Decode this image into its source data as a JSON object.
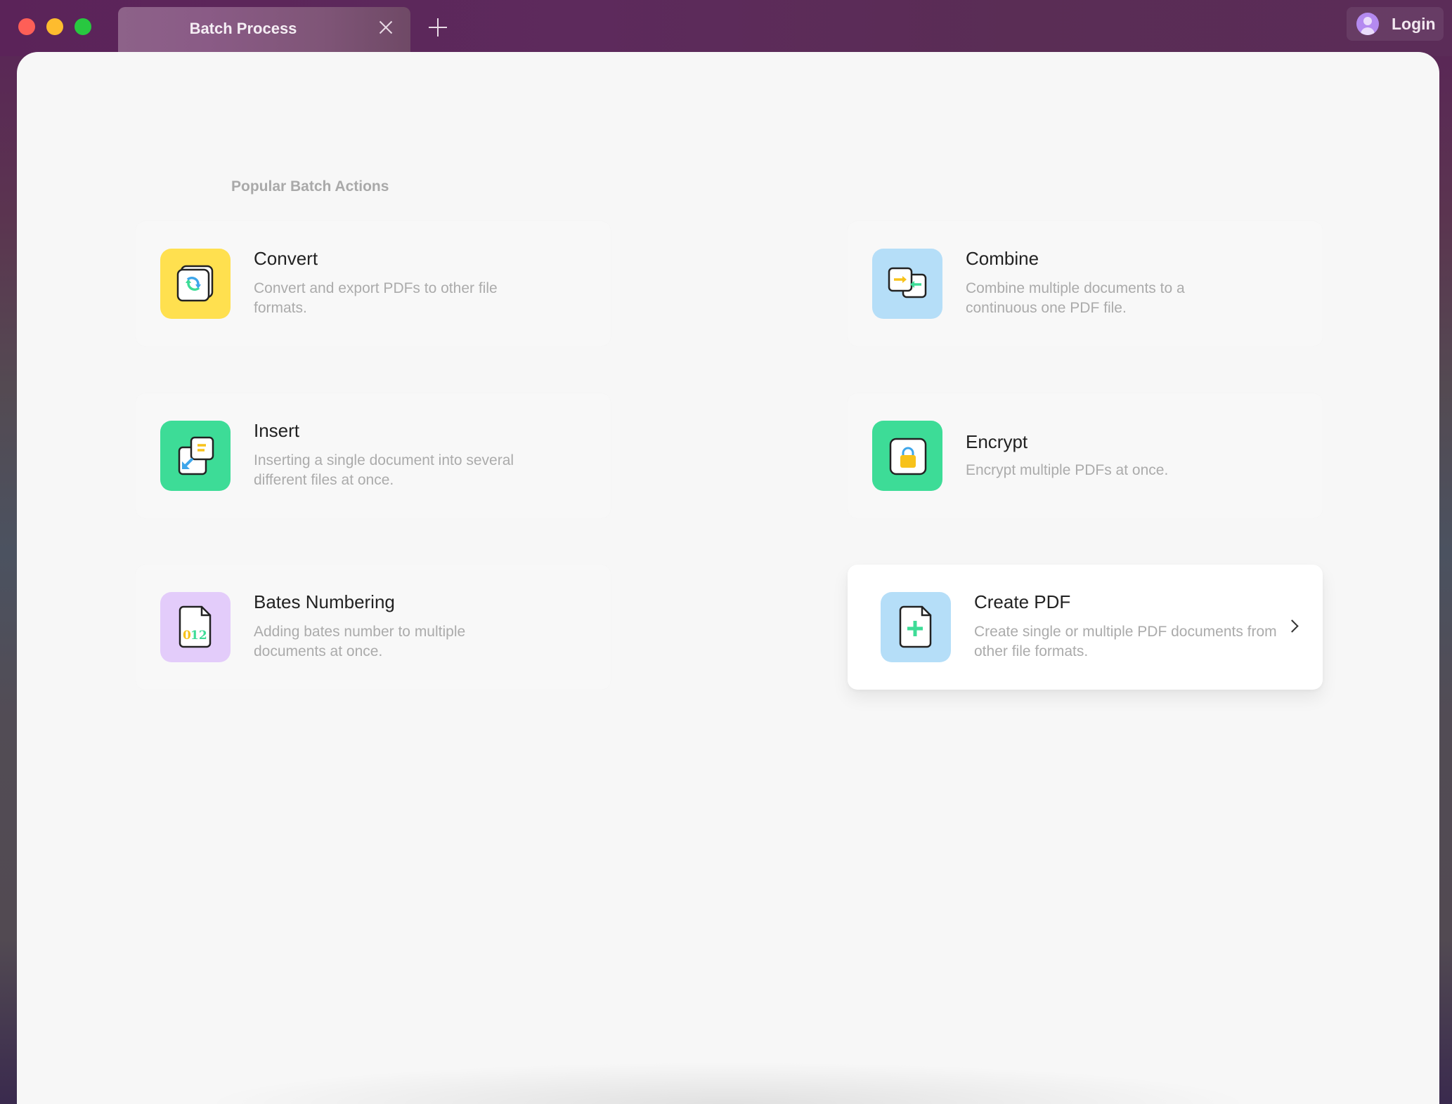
{
  "window": {
    "tab_title": "Batch Process",
    "login_label": "Login"
  },
  "main": {
    "section_title": "Popular Batch Actions",
    "actions": [
      {
        "title": "Convert",
        "description": "Convert and export PDFs to other file formats.",
        "icon": "convert-icon",
        "tile_color": "#ffe04f"
      },
      {
        "title": "Combine",
        "description": "Combine multiple documents to a continuous one PDF file.",
        "icon": "combine-icon",
        "tile_color": "#b5def8"
      },
      {
        "title": "Insert",
        "description": "Inserting a single document into several different files at once.",
        "icon": "insert-icon",
        "tile_color": "#3ddc97"
      },
      {
        "title": "Encrypt",
        "description": "Encrypt multiple PDFs at once.",
        "icon": "lock-icon",
        "tile_color": "#3ddc97"
      },
      {
        "title": "Bates Numbering",
        "description": "Adding bates number to multiple documents at once.",
        "icon": "bates-numbering-icon",
        "icon_text": "012",
        "tile_color": "#e3ccfa"
      },
      {
        "title": "Create PDF",
        "description": "Create single or multiple PDF documents from other file formats.",
        "icon": "create-pdf-icon",
        "tile_color": "#b5def8",
        "highlighted": true
      }
    ]
  }
}
